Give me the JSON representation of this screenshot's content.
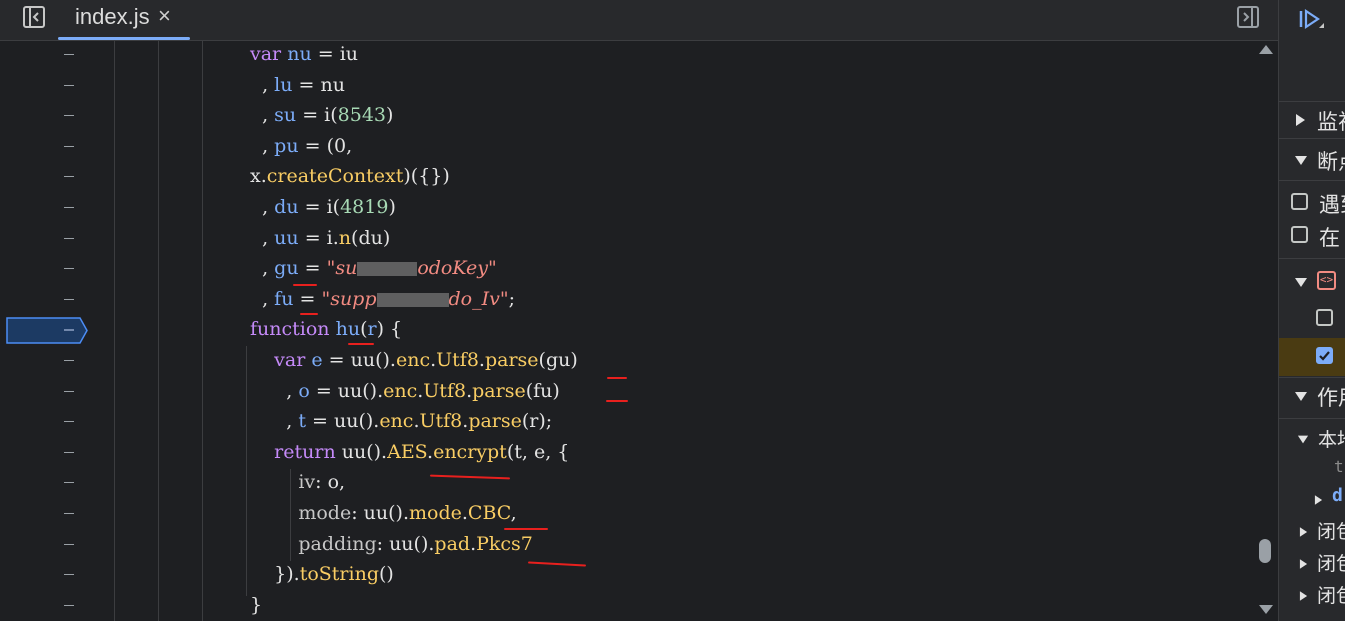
{
  "tab": {
    "filename": "index.js",
    "close": "×"
  },
  "code_lines": [
    [
      {
        "t": "var",
        "c": "kw"
      },
      {
        "t": " "
      },
      {
        "t": "nu",
        "c": "var"
      },
      {
        "t": " = "
      },
      {
        "t": "iu",
        "c": "pl"
      }
    ],
    [
      {
        "t": "  , "
      },
      {
        "t": "lu",
        "c": "var"
      },
      {
        "t": " = nu"
      }
    ],
    [
      {
        "t": "  , "
      },
      {
        "t": "su",
        "c": "var"
      },
      {
        "t": " = i("
      },
      {
        "t": "8543",
        "c": "num"
      },
      {
        "t": ")"
      }
    ],
    [
      {
        "t": "  , "
      },
      {
        "t": "pu",
        "c": "var"
      },
      {
        "t": " = (0,"
      }
    ],
    [
      {
        "t": "x."
      },
      {
        "t": "createContext",
        "c": "prop"
      },
      {
        "t": ")({})"
      }
    ],
    [
      {
        "t": "  , "
      },
      {
        "t": "du",
        "c": "var"
      },
      {
        "t": " = i("
      },
      {
        "t": "4819",
        "c": "num"
      },
      {
        "t": ")"
      }
    ],
    [
      {
        "t": "  , "
      },
      {
        "t": "uu",
        "c": "var"
      },
      {
        "t": " = i."
      },
      {
        "t": "n",
        "c": "prop"
      },
      {
        "t": "(du)"
      }
    ],
    [
      {
        "t": "  , "
      },
      {
        "t": "gu",
        "c": "var"
      },
      {
        "t": " = "
      },
      {
        "t": "\"su",
        "c": "str"
      },
      {
        "t": "REDACT1",
        "c": "redact"
      },
      {
        "t": "odoKey\"",
        "c": "str"
      }
    ],
    [
      {
        "t": "  , "
      },
      {
        "t": "fu",
        "c": "var"
      },
      {
        "t": " = "
      },
      {
        "t": "\"supp",
        "c": "str"
      },
      {
        "t": "REDACT2",
        "c": "redact"
      },
      {
        "t": "do_Iv\"",
        "c": "str"
      },
      {
        "t": ";"
      }
    ],
    [
      {
        "t": "function",
        "c": "kw"
      },
      {
        "t": " "
      },
      {
        "t": "hu",
        "c": "var"
      },
      {
        "t": "("
      },
      {
        "t": "r",
        "c": "var"
      },
      {
        "t": ") {"
      }
    ],
    [
      {
        "t": "    "
      },
      {
        "t": "var",
        "c": "kw"
      },
      {
        "t": " "
      },
      {
        "t": "e",
        "c": "var"
      },
      {
        "t": " = uu()."
      },
      {
        "t": "enc",
        "c": "prop"
      },
      {
        "t": "."
      },
      {
        "t": "Utf8",
        "c": "prop"
      },
      {
        "t": "."
      },
      {
        "t": "parse",
        "c": "prop"
      },
      {
        "t": "(gu)"
      }
    ],
    [
      {
        "t": "      , "
      },
      {
        "t": "o",
        "c": "var"
      },
      {
        "t": " = uu()."
      },
      {
        "t": "enc",
        "c": "prop"
      },
      {
        "t": "."
      },
      {
        "t": "Utf8",
        "c": "prop"
      },
      {
        "t": "."
      },
      {
        "t": "parse",
        "c": "prop"
      },
      {
        "t": "(fu)"
      }
    ],
    [
      {
        "t": "      , "
      },
      {
        "t": "t",
        "c": "var"
      },
      {
        "t": " = uu()."
      },
      {
        "t": "enc",
        "c": "prop"
      },
      {
        "t": "."
      },
      {
        "t": "Utf8",
        "c": "prop"
      },
      {
        "t": "."
      },
      {
        "t": "parse",
        "c": "prop"
      },
      {
        "t": "(r);"
      }
    ],
    [
      {
        "t": "    "
      },
      {
        "t": "return",
        "c": "kw"
      },
      {
        "t": " uu()."
      },
      {
        "t": "AES",
        "c": "prop"
      },
      {
        "t": "."
      },
      {
        "t": "encrypt",
        "c": "prop"
      },
      {
        "t": "(t, e, {"
      }
    ],
    [
      {
        "t": "        "
      },
      {
        "t": "iv",
        "c": "prop2"
      },
      {
        "t": ": o,"
      }
    ],
    [
      {
        "t": "        "
      },
      {
        "t": "mode",
        "c": "prop2"
      },
      {
        "t": ": uu()."
      },
      {
        "t": "mode",
        "c": "prop"
      },
      {
        "t": "."
      },
      {
        "t": "CBC",
        "c": "prop"
      },
      {
        "t": ","
      }
    ],
    [
      {
        "t": "        "
      },
      {
        "t": "padding",
        "c": "prop2"
      },
      {
        "t": ": uu()."
      },
      {
        "t": "pad",
        "c": "prop"
      },
      {
        "t": "."
      },
      {
        "t": "Pkcs7",
        "c": "prop"
      }
    ],
    [
      {
        "t": "    })."
      },
      {
        "t": "toString",
        "c": "prop"
      },
      {
        "t": "()"
      }
    ],
    [
      {
        "t": "}"
      }
    ]
  ],
  "panel": {
    "rows": [
      {
        "kind": "section-collapsed",
        "label": "监视"
      },
      {
        "kind": "section-expanded",
        "label": "断点"
      },
      {
        "kind": "checkbox",
        "label": "遇到"
      },
      {
        "kind": "checkbox",
        "label": "在"
      },
      {
        "kind": "file-group",
        "label": ""
      },
      {
        "kind": "bp-checkbox",
        "label": ""
      },
      {
        "kind": "bp-checkbox-checked",
        "label": ""
      },
      {
        "kind": "section-expanded",
        "label": "作用"
      },
      {
        "kind": "scope-expanded",
        "label": "本地"
      },
      {
        "kind": "scope-item",
        "label": "t"
      },
      {
        "kind": "scope-collapsed",
        "label": "d"
      },
      {
        "kind": "scope-collapsed",
        "label": "闭包"
      },
      {
        "kind": "scope-collapsed",
        "label": "闭包"
      },
      {
        "kind": "scope-collapsed",
        "label": "闭包"
      }
    ]
  },
  "colors": {
    "keyword": "#c58af9",
    "variable": "#7cacf8",
    "number": "#a8dab5",
    "string": "#f28b82",
    "property": "#f9cd64",
    "annotation": "#e8201e"
  }
}
